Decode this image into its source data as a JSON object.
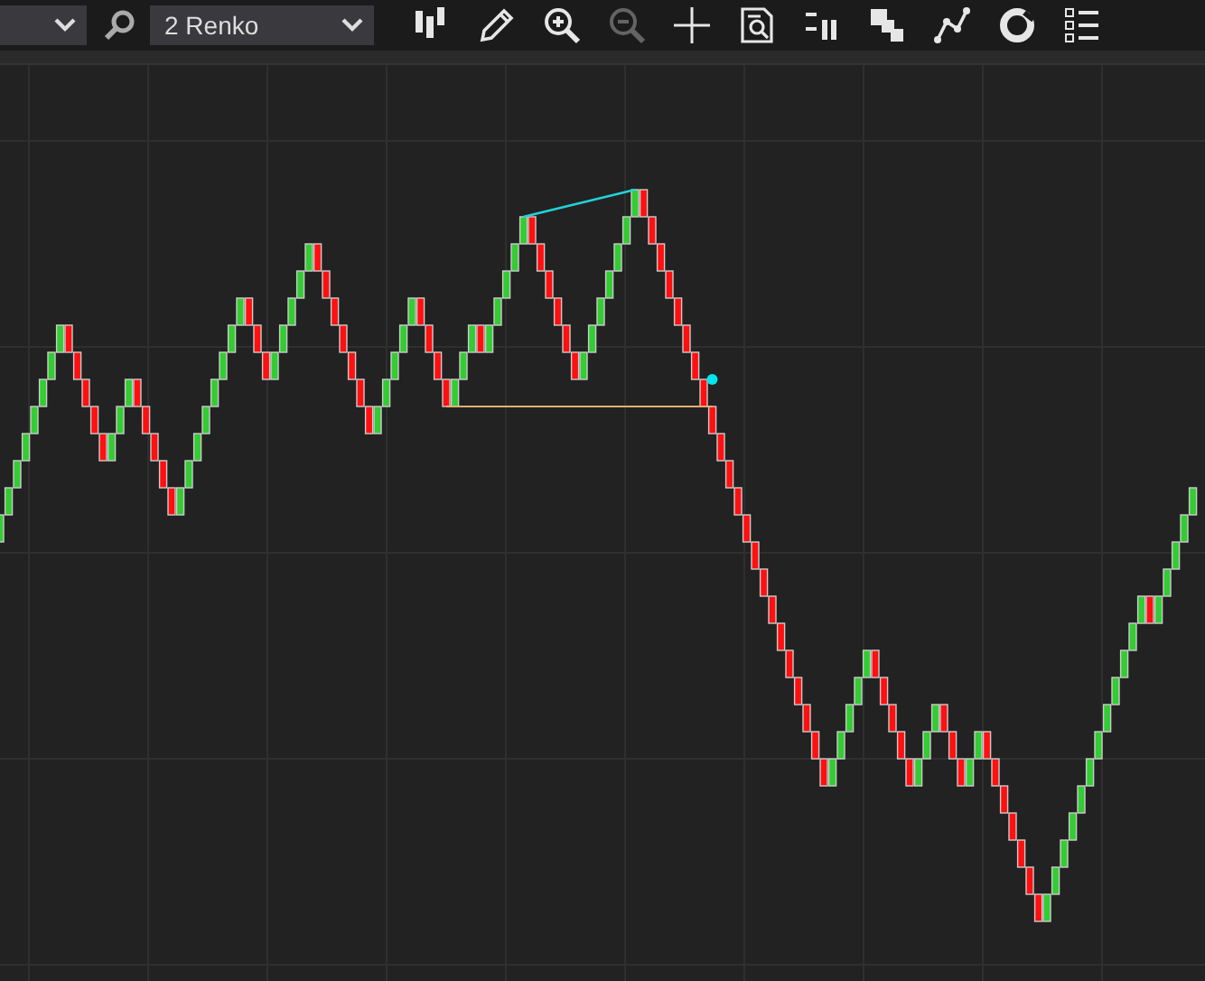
{
  "toolbar": {
    "chart_type": {
      "value": "2 Renko"
    },
    "tools": [
      {
        "kind": "candles",
        "disabled": false
      },
      {
        "kind": "pencil",
        "disabled": false
      },
      {
        "kind": "zoom-in",
        "disabled": false
      },
      {
        "kind": "zoom-out",
        "disabled": true
      },
      {
        "kind": "crosshair",
        "disabled": false
      },
      {
        "kind": "report",
        "disabled": false
      },
      {
        "kind": "bars",
        "disabled": false
      },
      {
        "kind": "layers",
        "disabled": false
      },
      {
        "kind": "nodes",
        "disabled": false
      },
      {
        "kind": "ring",
        "disabled": false
      },
      {
        "kind": "list",
        "disabled": false
      }
    ]
  }
}
